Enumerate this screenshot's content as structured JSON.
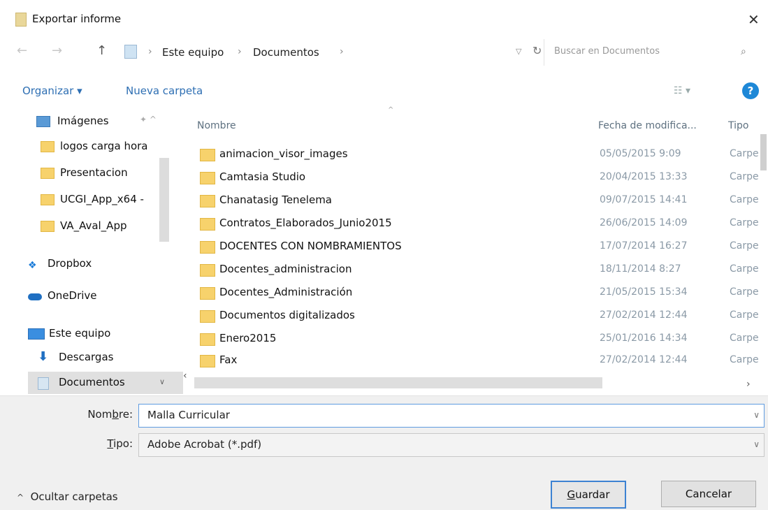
{
  "window": {
    "title": "Exportar informe",
    "close_glyph": "✕"
  },
  "address": {
    "crumbs": [
      "Este equipo",
      "Documentos"
    ],
    "search_placeholder": "Buscar en Documentos"
  },
  "toolbar": {
    "organize": "Organizar ▾",
    "new_folder": "Nueva carpeta"
  },
  "sidebar": {
    "items": [
      {
        "label": "Imágenes",
        "icon": "pictures-icon"
      },
      {
        "label": "logos carga hora",
        "icon": "folder-icon"
      },
      {
        "label": "Presentacion",
        "icon": "folder-icon"
      },
      {
        "label": "UCGI_App_x64 -",
        "icon": "folder-icon"
      },
      {
        "label": "VA_Aval_App",
        "icon": "folder-icon"
      },
      {
        "label": "Dropbox",
        "icon": "dropbox-icon"
      },
      {
        "label": "OneDrive",
        "icon": "onedrive-icon"
      },
      {
        "label": "Este equipo",
        "icon": "computer-icon"
      },
      {
        "label": "Descargas",
        "icon": "download-icon"
      },
      {
        "label": "Documentos",
        "icon": "documents-icon"
      }
    ]
  },
  "list": {
    "columns": {
      "name": "Nombre",
      "date": "Fecha de modifica...",
      "type": "Tipo"
    },
    "rows": [
      {
        "name": "animacion_visor_images",
        "date": "05/05/2015 9:09",
        "type": "Carpe"
      },
      {
        "name": "Camtasia Studio",
        "date": "20/04/2015 13:33",
        "type": "Carpe"
      },
      {
        "name": "Chanatasig Tenelema",
        "date": "09/07/2015 14:41",
        "type": "Carpe"
      },
      {
        "name": "Contratos_Elaborados_Junio2015",
        "date": "26/06/2015 14:09",
        "type": "Carpe"
      },
      {
        "name": "DOCENTES CON NOMBRAMIENTOS",
        "date": "17/07/2014 16:27",
        "type": "Carpe"
      },
      {
        "name": "Docentes_administracion",
        "date": "18/11/2014 8:27",
        "type": "Carpe"
      },
      {
        "name": "Docentes_Administración",
        "date": "21/05/2015 15:34",
        "type": "Carpe"
      },
      {
        "name": "Documentos digitalizados",
        "date": "27/02/2014 12:44",
        "type": "Carpe"
      },
      {
        "name": "Enero2015",
        "date": "25/01/2016 14:34",
        "type": "Carpe"
      },
      {
        "name": "Fax",
        "date": "27/02/2014 12:44",
        "type": "Carpe"
      }
    ]
  },
  "bottom": {
    "name_label_pre": "Nom",
    "name_label_u": "b",
    "name_label_post": "re:",
    "name_value": "Malla Curricular",
    "type_label_u": "T",
    "type_label_post": "ipo:",
    "type_value": "Adobe Acrobat (*.pdf)",
    "hide_folders": "Ocultar carpetas",
    "save_u": "G",
    "save_post": "uardar",
    "cancel": "Cancelar"
  }
}
